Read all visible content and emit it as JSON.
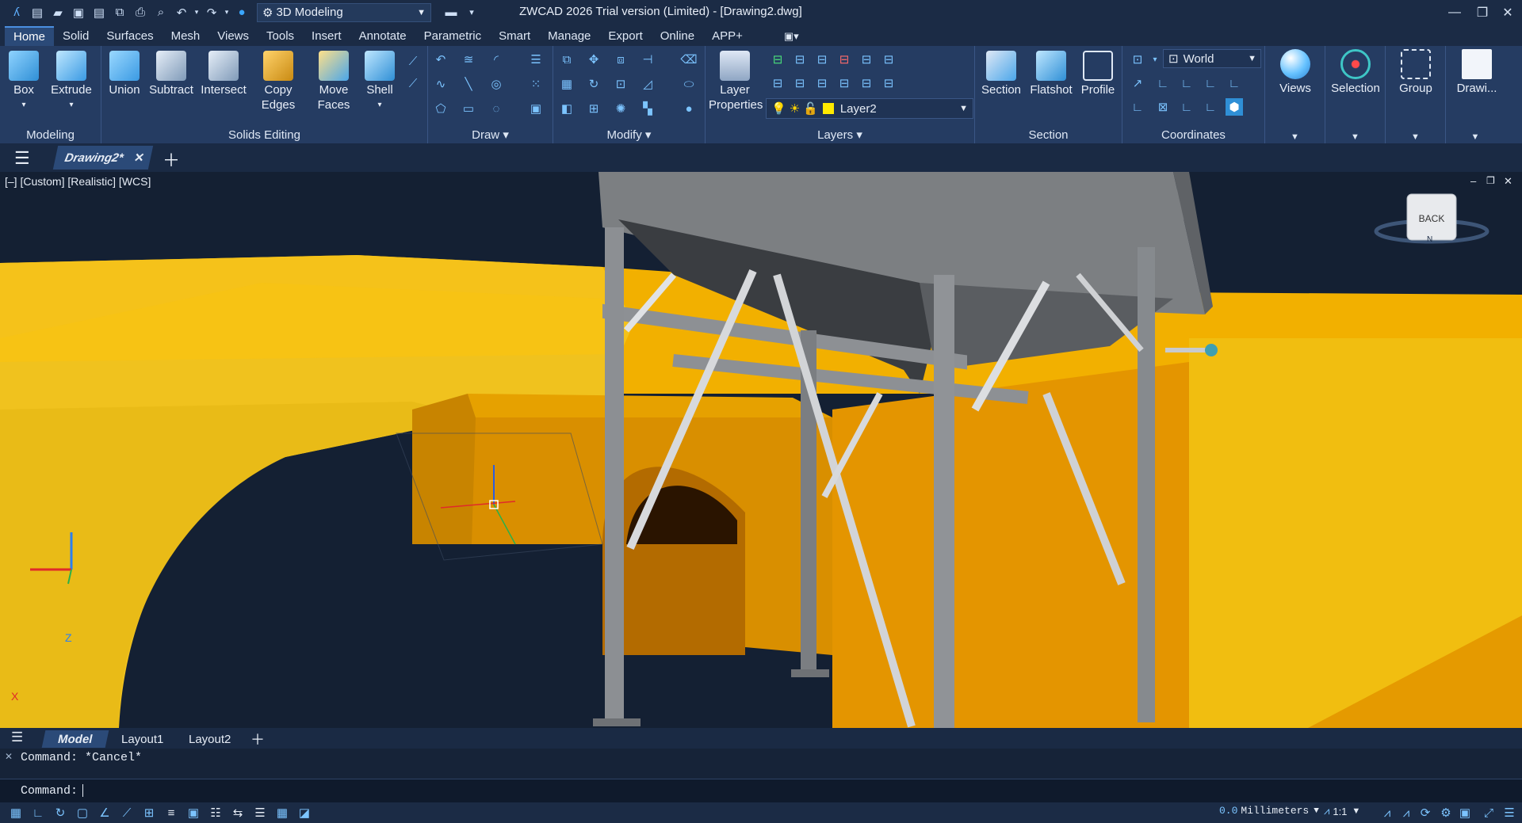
{
  "app": {
    "title": "ZWCAD 2026 Trial version (Limited) - [Drawing2.dwg]",
    "workspace": "3D Modeling"
  },
  "tabs": [
    "Home",
    "Solid",
    "Surfaces",
    "Mesh",
    "Views",
    "Tools",
    "Insert",
    "Annotate",
    "Parametric",
    "Smart",
    "Manage",
    "Export",
    "Online",
    "APP+"
  ],
  "ribbon": {
    "modeling": {
      "title": "Modeling",
      "box": "Box",
      "extrude": "Extrude"
    },
    "solids": {
      "title": "Solids Editing",
      "union": "Union",
      "subtract": "Subtract",
      "intersect": "Intersect",
      "copy_edges_1": "Copy",
      "copy_edges_2": "Edges",
      "move_faces_1": "Move",
      "move_faces_2": "Faces",
      "shell": "Shell"
    },
    "draw": {
      "title": "Draw"
    },
    "modify": {
      "title": "Modify"
    },
    "layers": {
      "title": "Layers",
      "layer_properties_1": "Layer",
      "layer_properties_2": "Properties",
      "current_layer": "Layer2"
    },
    "section": {
      "title": "Section",
      "section": "Section",
      "flatshot": "Flatshot",
      "profile": "Profile"
    },
    "coordinates": {
      "title": "Coordinates",
      "ucs": "World"
    },
    "views": "Views",
    "selection": "Selection",
    "group": "Group",
    "drawing": "Drawi..."
  },
  "document": {
    "tab": "Drawing2*"
  },
  "viewport": {
    "label": "[–] [Custom] [Realistic] [WCS]",
    "viewcube": "BACK",
    "compass_n": "N",
    "axis_x": "X",
    "axis_z": "Z"
  },
  "layouts": [
    "Model",
    "Layout1",
    "Layout2"
  ],
  "command": {
    "history": "Command: *Cancel*",
    "prompt": "Command:"
  },
  "status": {
    "units": "Millimeters",
    "scale": "1:1"
  },
  "colors": {
    "accent": "#4a8fe0",
    "terrain": "#f0b400",
    "steel": "#8a8c8e"
  }
}
